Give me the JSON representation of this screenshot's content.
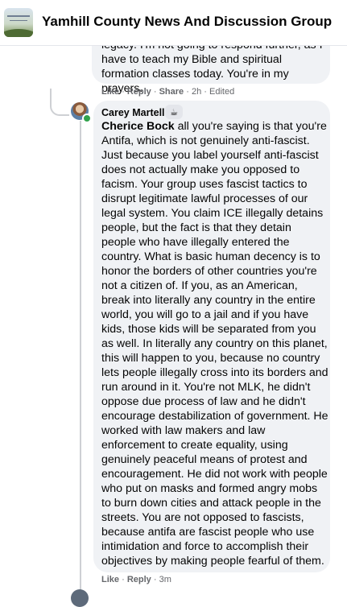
{
  "header": {
    "group_name": "Yamhill County News And Discussion Group"
  },
  "comment1": {
    "text": "legacy. I'm not going to respond further, as I have to teach my Bible and spiritual formation classes today. You're in my prayers.",
    "like_label": "Like",
    "reply_label": "Reply",
    "share_label": "Share",
    "time": "2h",
    "edited": "Edited"
  },
  "comment2": {
    "author": "Carey Martell",
    "badge_icon": "coffee-icon",
    "mention": "Cherice Bock",
    "text": " all you're saying is that you're Antifa, which is not genuinely anti-fascist. Just because you label yourself anti-fascist does not actually make you opposed to facism. Your group uses fascist tactics to disrupt legitimate lawful processes of our legal system. You claim ICE illegally detains people, but the fact is that they detain people who have illegally entered the country. What is basic human decency is to honor the borders of other countries you're not a citizen of. If you, as an American, break into literally any country in the entire world, you will go to a jail and if you have kids, those kids will be separated from you as well. In literally any country on this planet, this will happen to you, because no country lets people illegally cross into its borders and run around in it. You're not MLK, he didn't oppose due process of law and he didn't encourage destabilization of government. He worked with law makers and law enforcement to create equality, using genuinely peaceful means of protest and encouragement. He did not work with people who put on masks and formed angry mobs to burn down cities and attack people in the streets. You are not opposed to fascists, because antifa are fascist people who use intimidation and force to accomplish their objectives by making people fearful of them.",
    "like_label": "Like",
    "reply_label": "Reply",
    "time": "3m"
  },
  "colors": {
    "bubble": "#f0f2f5",
    "meta_text": "#65676b",
    "online": "#31a24c"
  }
}
